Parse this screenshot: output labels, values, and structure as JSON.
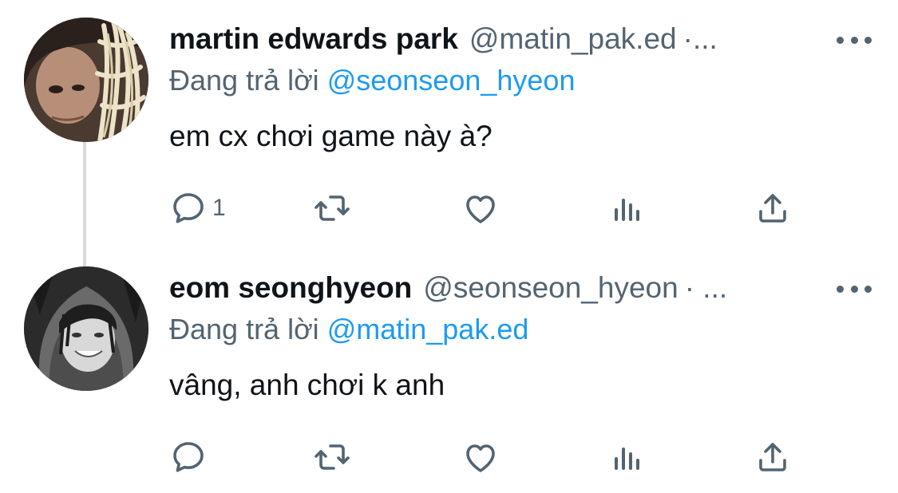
{
  "thread": {
    "tweets": [
      {
        "display_name": "martin edwards park",
        "handle": "@matin_pak.ed",
        "separator": "·...",
        "replying_label": "Đang trả lời",
        "replying_to": "@seonseon_hyeon",
        "text": "em cx chơi game này à?",
        "reply_count": "1",
        "avatar_icon": "person-with-noodles-avatar"
      },
      {
        "display_name": "eom seonghyeon",
        "handle": "@seonseon_hyeon",
        "separator": "· ...",
        "replying_label": "Đang trả lời",
        "replying_to": "@matin_pak.ed",
        "text": "vâng, anh chơi k anh",
        "reply_count": "",
        "avatar_icon": "person-hooded-bw-avatar"
      }
    ]
  },
  "colors": {
    "text_primary": "#0f1419",
    "text_secondary": "#536471",
    "link": "#1d9bf0",
    "thread_line": "#d6d9db"
  },
  "icons": [
    "reply-icon",
    "retweet-icon",
    "like-icon",
    "views-icon",
    "share-icon",
    "more-icon"
  ]
}
